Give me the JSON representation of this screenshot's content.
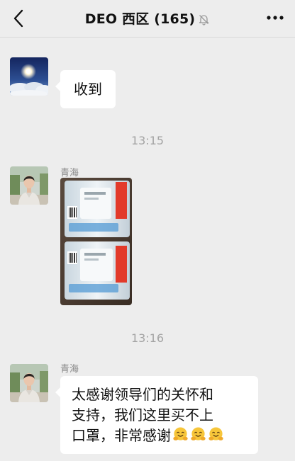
{
  "header": {
    "title": "DEO 西区 (165)",
    "back_icon": "back-chevron-icon",
    "mute_icon": "bell-off-icon",
    "more_icon": "more-dots-icon"
  },
  "messages": [
    {
      "sender": "",
      "text": "收到",
      "avatar_icon": "sky-clouds-avatar"
    },
    {
      "timestamp": "13:15"
    },
    {
      "sender": "青海",
      "type": "image",
      "image_desc_icon": "mask-packages-photo"
    },
    {
      "timestamp": "13:16"
    },
    {
      "sender": "青海",
      "text_lines": [
        "太感谢领导们的关怀和",
        "支持，我们这里买不上",
        "口罩，非常感谢"
      ],
      "emoji_count": 3,
      "emoji_icon": "hugging-face-emoji"
    }
  ],
  "colors": {
    "background": "#ededed",
    "bubble": "#ffffff",
    "timestamp": "#a3a3a3",
    "sender": "#888888"
  }
}
